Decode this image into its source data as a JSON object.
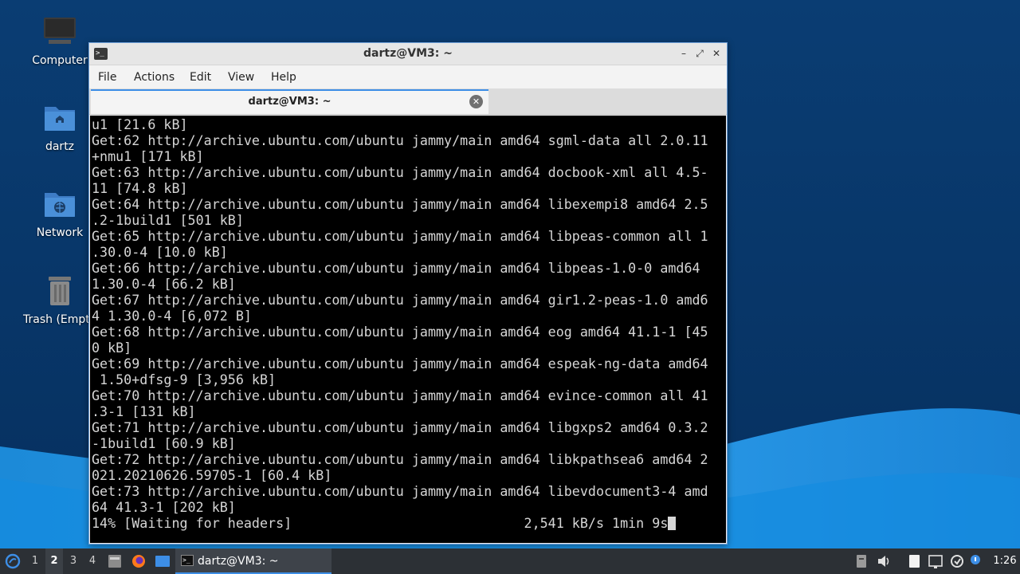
{
  "desktop": {
    "icons": [
      {
        "label": "Computer",
        "icon": "computer-icon"
      },
      {
        "label": "dartz",
        "icon": "home-folder-icon"
      },
      {
        "label": "Network",
        "icon": "network-folder-icon"
      },
      {
        "label": "Trash (Empt",
        "icon": "trash-icon"
      }
    ]
  },
  "window": {
    "title": "dartz@VM3: ~",
    "menu": [
      "File",
      "Actions",
      "Edit",
      "View",
      "Help"
    ],
    "tab_label": "dartz@VM3: ~",
    "terminal_lines": [
      "u1 [21.6 kB]",
      "Get:62 http://archive.ubuntu.com/ubuntu jammy/main amd64 sgml-data all 2.0.11",
      "+nmu1 [171 kB]",
      "Get:63 http://archive.ubuntu.com/ubuntu jammy/main amd64 docbook-xml all 4.5-",
      "11 [74.8 kB]",
      "Get:64 http://archive.ubuntu.com/ubuntu jammy/main amd64 libexempi8 amd64 2.5",
      ".2-1build1 [501 kB]",
      "Get:65 http://archive.ubuntu.com/ubuntu jammy/main amd64 libpeas-common all 1",
      ".30.0-4 [10.0 kB]",
      "Get:66 http://archive.ubuntu.com/ubuntu jammy/main amd64 libpeas-1.0-0 amd64",
      "1.30.0-4 [66.2 kB]",
      "Get:67 http://archive.ubuntu.com/ubuntu jammy/main amd64 gir1.2-peas-1.0 amd6",
      "4 1.30.0-4 [6,072 B]",
      "Get:68 http://archive.ubuntu.com/ubuntu jammy/main amd64 eog amd64 41.1-1 [45",
      "0 kB]",
      "Get:69 http://archive.ubuntu.com/ubuntu jammy/main amd64 espeak-ng-data amd64",
      " 1.50+dfsg-9 [3,956 kB]",
      "Get:70 http://archive.ubuntu.com/ubuntu jammy/main amd64 evince-common all 41",
      ".3-1 [131 kB]",
      "Get:71 http://archive.ubuntu.com/ubuntu jammy/main amd64 libgxps2 amd64 0.3.2",
      "-1build1 [60.9 kB]",
      "Get:72 http://archive.ubuntu.com/ubuntu jammy/main amd64 libkpathsea6 amd64 2",
      "021.20210626.59705-1 [60.4 kB]",
      "Get:73 http://archive.ubuntu.com/ubuntu jammy/main amd64 libevdocument3-4 amd",
      "64 41.3-1 [202 kB]",
      "14% [Waiting for headers]                             2,541 kB/s 1min 9s"
    ]
  },
  "taskbar": {
    "workspaces": [
      "1",
      "2",
      "3",
      "4"
    ],
    "active_workspace": "2",
    "task_label": "dartz@VM3: ~",
    "clock": "1:26"
  },
  "colors": {
    "accent": "#3d8ee6",
    "terminal_bg": "#000000",
    "terminal_fg": "#d6d6d6",
    "taskbar_bg": "#2c3035"
  }
}
